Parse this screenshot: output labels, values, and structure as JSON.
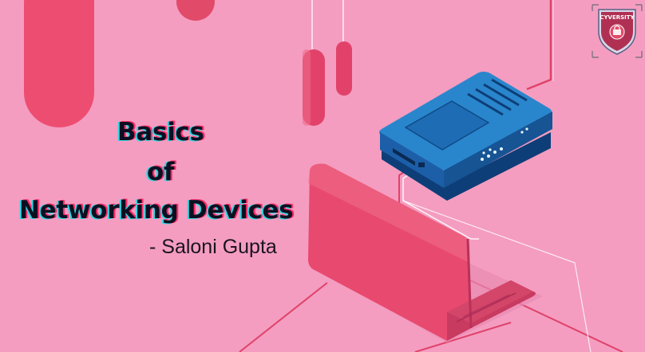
{
  "title": {
    "line1": "Basics",
    "line2": "of",
    "line3": "Networking Devices"
  },
  "author": "- Saloni Gupta",
  "logo": {
    "text": "CYVERSITY"
  },
  "colors": {
    "background": "#f49dc0",
    "accent_pink": "#ee4d72",
    "router_blue": "#1f72b8",
    "laptop_pink": "#e8496f"
  },
  "icons": [
    "router-icon",
    "laptop-icon",
    "shield-logo-icon"
  ]
}
